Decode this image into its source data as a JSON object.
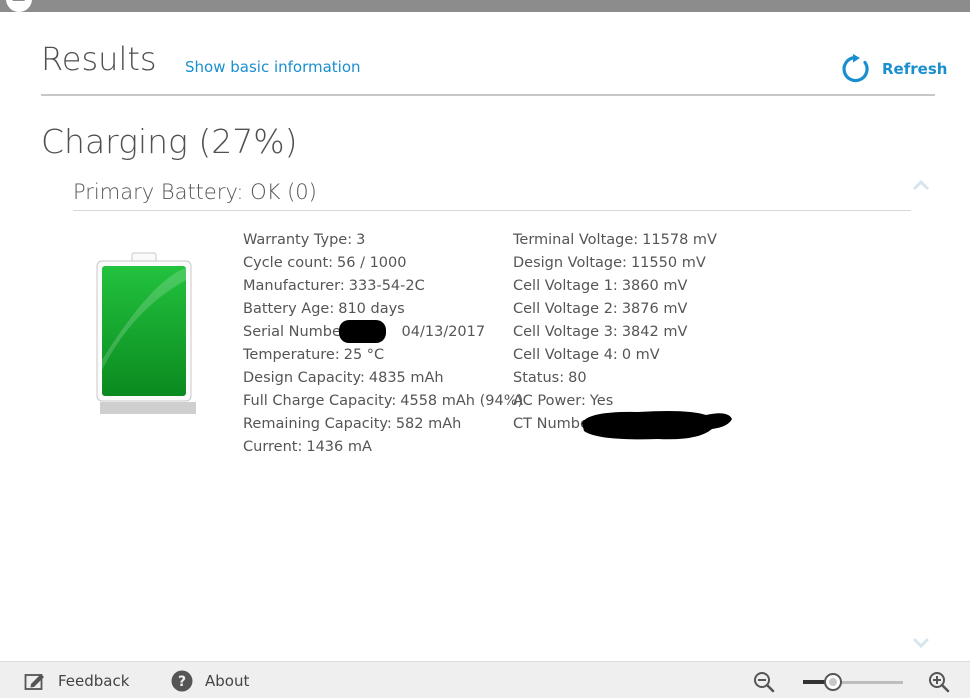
{
  "header": {
    "title": "Results",
    "basic_info_link": "Show basic information",
    "refresh_label": "Refresh"
  },
  "status": {
    "charging_text": "Charging (27%)",
    "charge_level_percent": 27
  },
  "battery": {
    "section_title": "Primary Battery:  OK (0)",
    "left_fields": [
      {
        "label": "Warranty Type:",
        "value": "3"
      },
      {
        "label": "Cycle count:",
        "value": "56 / 1000"
      },
      {
        "label": "Manufacturer:",
        "value": "333-54-2C"
      },
      {
        "label": "Battery Age:",
        "value": "810 days"
      },
      {
        "label": "Serial Number:",
        "value": "04/13/2017"
      },
      {
        "label": "Temperature:",
        "value": "25 °C"
      },
      {
        "label": "Design Capacity:",
        "value": "4835 mAh"
      },
      {
        "label": "Full Charge Capacity:",
        "value": "4558 mAh (94%)"
      },
      {
        "label": "Remaining Capacity:",
        "value": "582 mAh"
      },
      {
        "label": "Current:",
        "value": "1436 mA"
      }
    ],
    "right_fields": [
      {
        "label": "Terminal Voltage:",
        "value": "11578 mV"
      },
      {
        "label": "Design Voltage:",
        "value": "11550 mV"
      },
      {
        "label": "Cell Voltage 1:",
        "value": "3860 mV"
      },
      {
        "label": "Cell Voltage 2:",
        "value": "3876 mV"
      },
      {
        "label": "Cell Voltage 3:",
        "value": "3842 mV"
      },
      {
        "label": "Cell Voltage 4:",
        "value": "0 mV"
      },
      {
        "label": "Status:",
        "value": "80"
      },
      {
        "label": "AC Power:",
        "value": "Yes"
      },
      {
        "label": "CT Number",
        "value": ""
      }
    ]
  },
  "footer": {
    "feedback_label": "Feedback",
    "about_label": "About",
    "zoom_level": 0.3
  },
  "colors": {
    "accent": "#1a8fcf",
    "battery_green": "#1fb83a",
    "topbar": "#8c8c8c"
  }
}
